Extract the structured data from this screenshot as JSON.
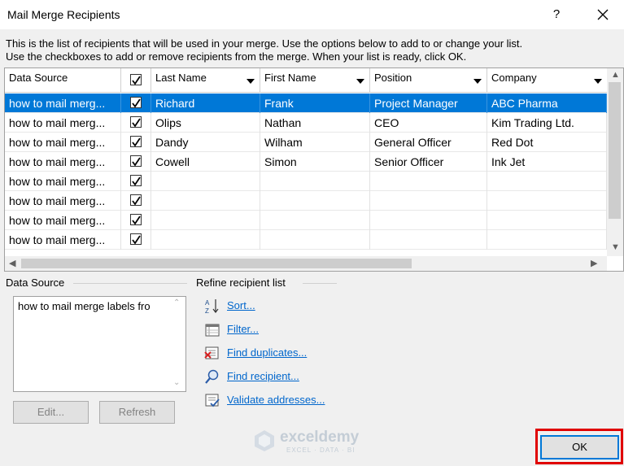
{
  "window": {
    "title": "Mail Merge Recipients",
    "help_label": "?"
  },
  "description": {
    "line1": "This is the list of recipients that will be used in your merge.  Use the options below to add to or change your list.",
    "line2": "Use the checkboxes to add or remove recipients from the merge.  When your list is ready, click OK."
  },
  "table": {
    "headers": {
      "data_source": "Data Source",
      "last_name": "Last Name",
      "first_name": "First Name",
      "position": "Position",
      "company": "Company"
    },
    "rows": [
      {
        "source": "how to mail merg...",
        "checked": true,
        "last": "Richard",
        "first": "Frank",
        "position": "Project Manager",
        "company": "ABC Pharma",
        "selected": true
      },
      {
        "source": "how to mail merg...",
        "checked": true,
        "last": "Olips",
        "first": "Nathan",
        "position": "CEO",
        "company": "Kim Trading Ltd.",
        "selected": false
      },
      {
        "source": "how to mail merg...",
        "checked": true,
        "last": "Dandy",
        "first": "Wilham",
        "position": "General Officer",
        "company": "Red Dot",
        "selected": false
      },
      {
        "source": "how to mail merg...",
        "checked": true,
        "last": "Cowell",
        "first": "Simon",
        "position": "Senior Officer",
        "company": "Ink Jet",
        "selected": false
      },
      {
        "source": "how to mail merg...",
        "checked": true,
        "last": "",
        "first": "",
        "position": "",
        "company": "",
        "selected": false
      },
      {
        "source": "how to mail merg...",
        "checked": true,
        "last": "",
        "first": "",
        "position": "",
        "company": "",
        "selected": false
      },
      {
        "source": "how to mail merg...",
        "checked": true,
        "last": "",
        "first": "",
        "position": "",
        "company": "",
        "selected": false
      },
      {
        "source": "how to mail merg...",
        "checked": true,
        "last": "",
        "first": "",
        "position": "",
        "company": "",
        "selected": false
      }
    ]
  },
  "data_source_panel": {
    "label": "Data Source",
    "item": "how to mail merge labels fro",
    "edit_label": "Edit...",
    "refresh_label": "Refresh"
  },
  "refine": {
    "label": "Refine recipient list",
    "sort": "Sort...",
    "filter": "Filter...",
    "find_duplicates": "Find duplicates...",
    "find_recipient": "Find recipient...",
    "validate": "Validate addresses..."
  },
  "watermark": {
    "name": "exceldemy",
    "tagline": "EXCEL · DATA · BI"
  },
  "ok_label": "OK",
  "colors": {
    "selection": "#0078d7",
    "link": "#0066cc",
    "highlight": "#e00000"
  }
}
